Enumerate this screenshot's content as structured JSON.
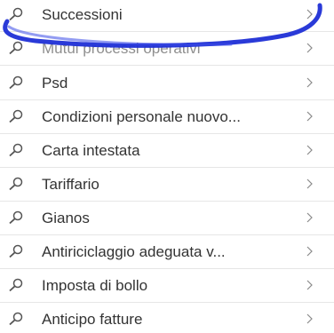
{
  "items": [
    {
      "label": "Successioni",
      "icon": "search-icon",
      "chevron": "chevron-right-icon"
    },
    {
      "label": "Mutui processi operativi",
      "icon": "search-icon",
      "chevron": "chevron-right-icon"
    },
    {
      "label": "Psd",
      "icon": "search-icon",
      "chevron": "chevron-right-icon"
    },
    {
      "label": "Condizioni personale nuovo...",
      "icon": "search-icon",
      "chevron": "chevron-right-icon"
    },
    {
      "label": "Carta intestata",
      "icon": "search-icon",
      "chevron": "chevron-right-icon"
    },
    {
      "label": "Tariffario",
      "icon": "search-icon",
      "chevron": "chevron-right-icon"
    },
    {
      "label": "Gianos",
      "icon": "search-icon",
      "chevron": "chevron-right-icon"
    },
    {
      "label": "Antiriciclaggio adeguata v...",
      "icon": "search-icon",
      "chevron": "chevron-right-icon"
    },
    {
      "label": "Imposta di bollo",
      "icon": "search-icon",
      "chevron": "chevron-right-icon"
    },
    {
      "label": "Anticipo fatture",
      "icon": "search-icon",
      "chevron": "chevron-right-icon"
    }
  ],
  "colors": {
    "text": "#333333",
    "icon": "#555555",
    "chevron": "#8a8a8a",
    "separator": "#e6e6e6",
    "highlight_ink": "#1f2fd6"
  }
}
